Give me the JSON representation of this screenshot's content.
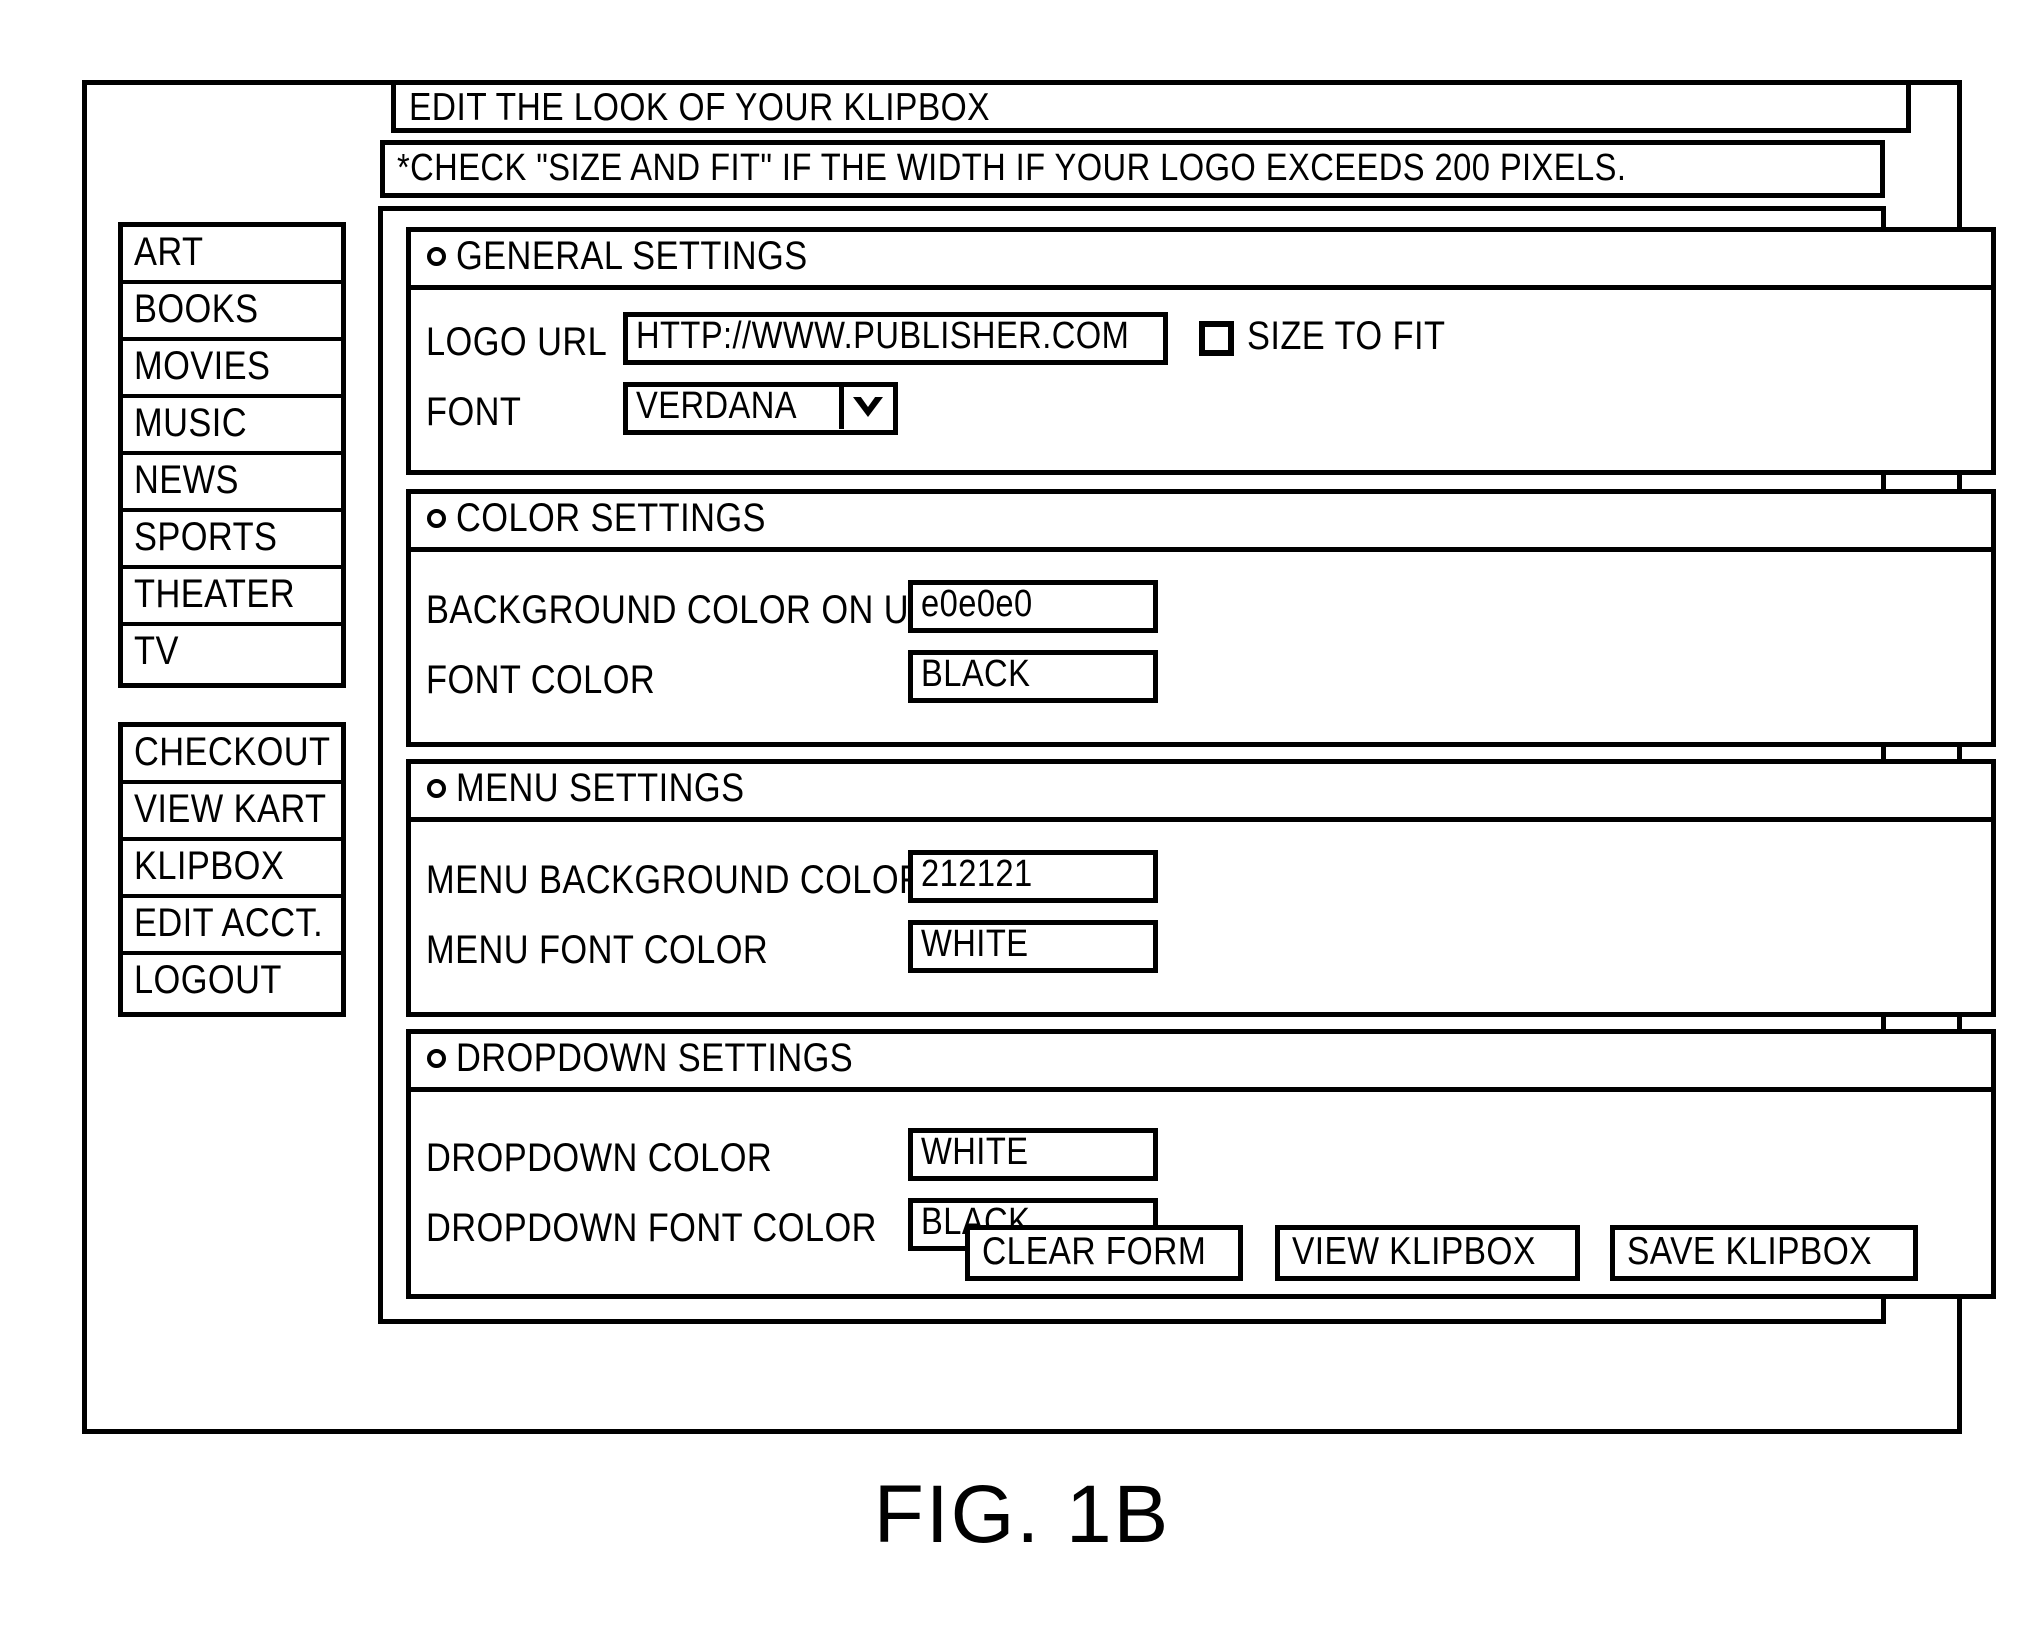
{
  "figure": {
    "caption": "FIG. 1B"
  },
  "header": {
    "title": "EDIT THE LOOK OF YOUR KLIPBOX",
    "note": "*CHECK \"SIZE AND FIT\" IF THE WIDTH IF YOUR LOGO EXCEEDS 200 PIXELS."
  },
  "sidebar": {
    "categories": [
      {
        "label": "ART"
      },
      {
        "label": "BOOKS"
      },
      {
        "label": "MOVIES"
      },
      {
        "label": "MUSIC"
      },
      {
        "label": "NEWS"
      },
      {
        "label": "SPORTS"
      },
      {
        "label": "THEATER"
      },
      {
        "label": "TV"
      }
    ],
    "account": [
      {
        "label": "CHECKOUT"
      },
      {
        "label": "VIEW KART"
      },
      {
        "label": "KLIPBOX"
      },
      {
        "label": "EDIT ACCT."
      },
      {
        "label": "LOGOUT"
      }
    ]
  },
  "sections": {
    "general": {
      "title": "GENERAL SETTINGS",
      "logo_url_label": "LOGO URL",
      "logo_url_value": "HTTP://WWW.PUBLISHER.COM",
      "size_to_fit_label": "SIZE TO FIT",
      "size_to_fit_checked": false,
      "font_label": "FONT",
      "font_value": "VERDANA",
      "font_dropdown_icon": "chevron-down-icon"
    },
    "color": {
      "title": "COLOR SETTINGS",
      "background_color_label": "BACKGROUND COLOR ON URL",
      "background_color_value": "e0e0e0",
      "font_color_label": "FONT COLOR",
      "font_color_value": "BLACK"
    },
    "menu": {
      "title": "MENU SETTINGS",
      "menu_background_label": "MENU BACKGROUND COLOR",
      "menu_background_value": "212121",
      "menu_font_label": "MENU FONT COLOR",
      "menu_font_value": "WHITE"
    },
    "dropdown": {
      "title": "DROPDOWN SETTINGS",
      "dropdown_color_label": "DROPDOWN COLOR",
      "dropdown_color_value": "WHITE",
      "dropdown_font_label": "DROPDOWN FONT COLOR",
      "dropdown_font_value": "BLACK"
    }
  },
  "buttons": {
    "clear_form": "CLEAR FORM",
    "view_klipbox": "VIEW KLIPBOX",
    "save_klipbox": "SAVE KLIPBOX"
  },
  "colors": {
    "ink": "#000000",
    "paper": "#ffffff"
  }
}
